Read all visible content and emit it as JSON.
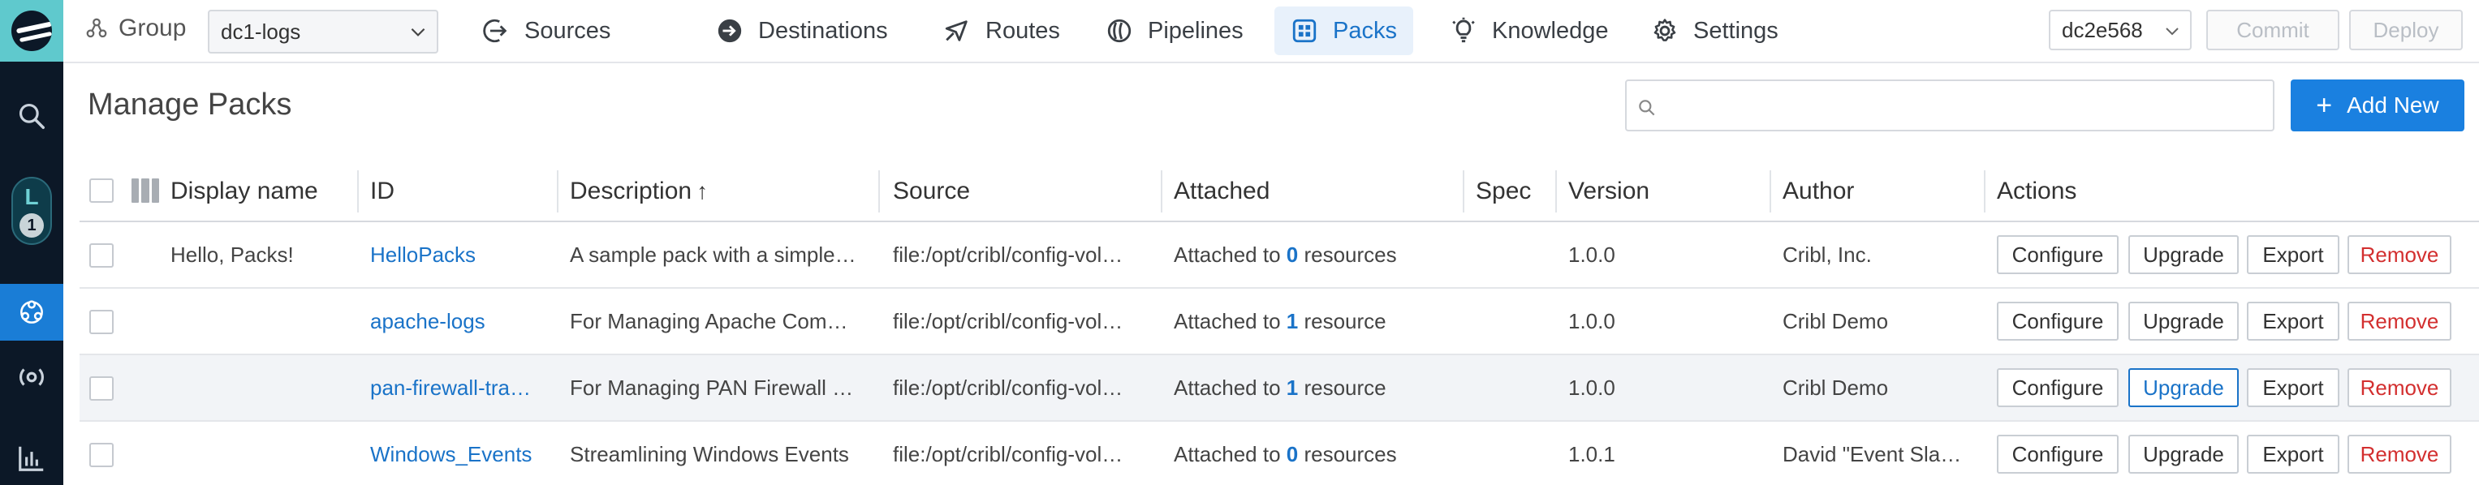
{
  "rail": {
    "user_initial": "L",
    "user_badge": "1"
  },
  "topbar": {
    "group_label": "Group",
    "group_value": "dc1-logs",
    "nav": [
      {
        "label": "Sources",
        "icon": "arrow-in-circle-icon"
      },
      {
        "label": "Destinations",
        "icon": "arrow-out-circle-icon"
      },
      {
        "label": "Routes",
        "icon": "routes-icon"
      },
      {
        "label": "Pipelines",
        "icon": "pipelines-icon"
      },
      {
        "label": "Packs",
        "icon": "packs-icon"
      },
      {
        "label": "Knowledge",
        "icon": "lightbulb-icon"
      },
      {
        "label": "Settings",
        "icon": "gear-icon"
      }
    ],
    "active_nav": "Packs",
    "commit_value": "dc2e568",
    "commit_label": "Commit",
    "deploy_label": "Deploy"
  },
  "main": {
    "title": "Manage Packs",
    "search_placeholder": "",
    "add_new_label": "Add New"
  },
  "table": {
    "columns": [
      "Display name",
      "ID",
      "Description",
      "Source",
      "Attached",
      "Spec",
      "Version",
      "Author",
      "Actions"
    ],
    "sort_column": "Description",
    "rows": [
      {
        "display_name": "Hello, Packs!",
        "id": "HelloPacks",
        "description": "A sample pack with a simple…",
        "source": "file:/opt/cribl/config-vol…",
        "attached_prefix": "Attached to ",
        "attached_count": "0",
        "attached_suffix": " resources",
        "spec": "",
        "version": "1.0.0",
        "author": "Cribl, Inc."
      },
      {
        "display_name": "",
        "id": "apache-logs",
        "description": "For Managing Apache Com…",
        "source": "file:/opt/cribl/config-vol…",
        "attached_prefix": "Attached to ",
        "attached_count": "1",
        "attached_suffix": " resource",
        "spec": "",
        "version": "1.0.0",
        "author": "Cribl Demo"
      },
      {
        "display_name": "",
        "id": "pan-firewall-tra…",
        "description": "For Managing PAN Firewall …",
        "source": "file:/opt/cribl/config-vol…",
        "attached_prefix": "Attached to ",
        "attached_count": "1",
        "attached_suffix": " resource",
        "spec": "",
        "version": "1.0.0",
        "author": "Cribl Demo"
      },
      {
        "display_name": "",
        "id": "Windows_Events",
        "description": "Streamlining Windows Events",
        "source": "file:/opt/cribl/config-vol…",
        "attached_prefix": "Attached to ",
        "attached_count": "0",
        "attached_suffix": " resources",
        "spec": "",
        "version": "1.0.1",
        "author": "David \"Event Sla…"
      }
    ],
    "actions": {
      "configure": "Configure",
      "upgrade": "Upgrade",
      "export": "Export",
      "remove": "Remove"
    }
  }
}
